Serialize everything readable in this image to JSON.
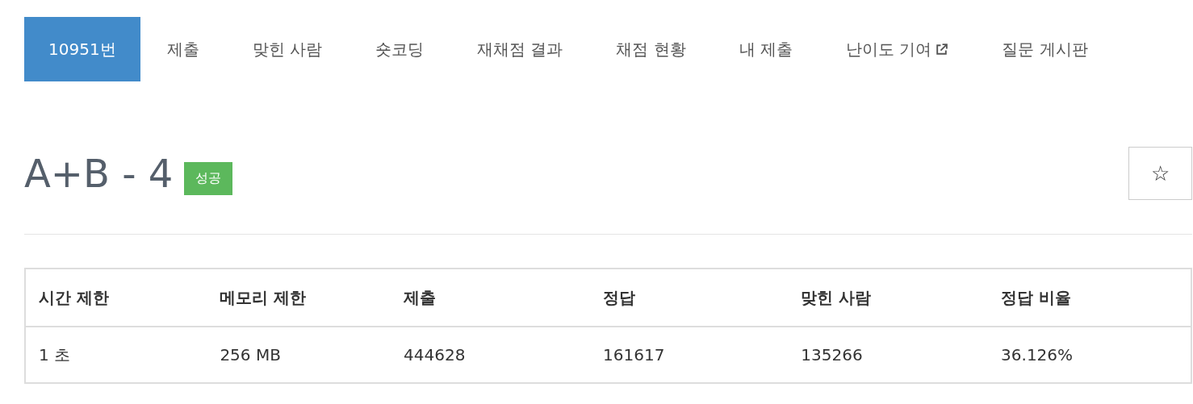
{
  "tabs": [
    {
      "label": "10951번",
      "selected": true,
      "external": false
    },
    {
      "label": "제출",
      "selected": false,
      "external": false
    },
    {
      "label": "맞힌 사람",
      "selected": false,
      "external": false
    },
    {
      "label": "숏코딩",
      "selected": false,
      "external": false
    },
    {
      "label": "재채점 결과",
      "selected": false,
      "external": false
    },
    {
      "label": "채점 현황",
      "selected": false,
      "external": false
    },
    {
      "label": "내 제출",
      "selected": false,
      "external": false
    },
    {
      "label": "난이도 기여",
      "selected": false,
      "external": true
    },
    {
      "label": "질문 게시판",
      "selected": false,
      "external": false
    }
  ],
  "problem": {
    "title": "A+B - 4",
    "badge": "성공",
    "favorite_button": "☆"
  },
  "table": {
    "columns": [
      "시간 제한",
      "메모리 제한",
      "제출",
      "정답",
      "맞힌 사람",
      "정답 비율"
    ],
    "rows": [
      [
        "1 초",
        "256 MB",
        "444628",
        "161617",
        "135266",
        "36.126%"
      ]
    ]
  }
}
